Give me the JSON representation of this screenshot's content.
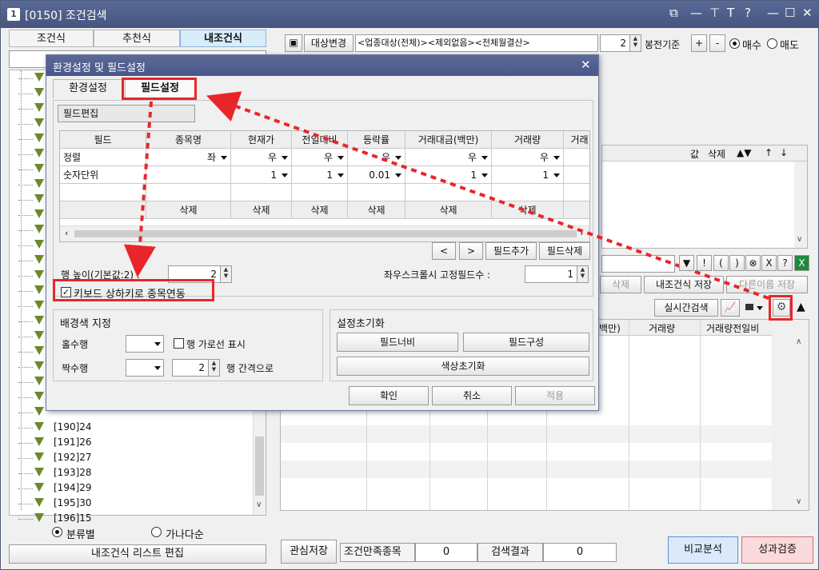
{
  "window": {
    "badge": "1",
    "title": "[0150] 조건검색",
    "controls": [
      "⧉",
      "—",
      "⊤",
      "T",
      "?",
      "—",
      "☐",
      "✕"
    ]
  },
  "left": {
    "tabs": [
      "조건식",
      "추천식",
      "내조건식"
    ],
    "tree_items": [
      "[190]24",
      "[191]26",
      "[192]27",
      "[193]28",
      "[194]29",
      "[195]30",
      "[196]15"
    ],
    "sort_options": [
      "분류별",
      "가나다순"
    ],
    "edit_button": "내조건식 리스트 편집"
  },
  "toolbar": {
    "target_change": "대상변경",
    "target_text": "<업종대상(전체)><제외없음><전체월결산>",
    "count_value": "2",
    "candle_label": "봉전기준",
    "plus": "+",
    "minus": "-",
    "buy_label": "매수",
    "sell_label": "매도"
  },
  "right_grid": {
    "headers": [
      "값",
      "삭제",
      "▲▼",
      "↑",
      "↓"
    ]
  },
  "formula_bar": {
    "buttons": [
      "▼",
      "!",
      "(",
      ")",
      "⊗",
      "X",
      "?",
      "X"
    ]
  },
  "actions": {
    "delete": "삭제",
    "my_condition_save": "내조건식 저장",
    "save_as": "다른이름 저장",
    "realtime_search": "실시간검색"
  },
  "result_grid": {
    "headers": [
      "백만)",
      "거래량",
      "거래량전일비"
    ]
  },
  "bottom": {
    "interest_save": "관심저장",
    "satisfy_label": "조건만족종목",
    "satisfy_value": "0",
    "result_label": "검색결과",
    "result_value": "0",
    "compare": "비교분석",
    "performance": "성과검증"
  },
  "dialog": {
    "title": "환경설정 및 필드설정",
    "tabs": [
      "환경설정",
      "필드설정"
    ],
    "field_edit": "필드편집",
    "field_table": {
      "headers": [
        "필드",
        "종목명",
        "현재가",
        "전일대비",
        "등락률",
        "거래대금(백만)",
        "거래량",
        "거래"
      ],
      "row_align": [
        "정렬",
        "좌",
        "우",
        "우",
        "우",
        "우",
        "우"
      ],
      "row_unit": [
        "숫자단위",
        "",
        "1",
        "1",
        "0.01",
        "1",
        "1"
      ],
      "row_delete": [
        "삭제",
        "삭제",
        "삭제",
        "삭제",
        "삭제",
        "삭제"
      ]
    },
    "nav_prev": "<",
    "nav_next": ">",
    "add_field": "필드추가",
    "delete_field": "필드삭제",
    "row_height_label": "행 높이(기본값:2) :",
    "row_height_value": "2",
    "fixed_fields_label": "좌우스크롤시 고정필드수 :",
    "fixed_fields_value": "1",
    "keyboard_link": "키보드 상하키로 종목연동",
    "bg_group_title": "배경색 지정",
    "odd_row": "홀수행",
    "even_row": "짝수행",
    "row_line_label": "행 가로선 표시",
    "interval_value": "2",
    "interval_label": "행 간격으로",
    "reset_group_title": "설정초기화",
    "reset_width": "필드너비",
    "reset_fields": "필드구성",
    "reset_color": "색상초기화",
    "ok": "확인",
    "cancel": "취소",
    "apply": "적용"
  }
}
